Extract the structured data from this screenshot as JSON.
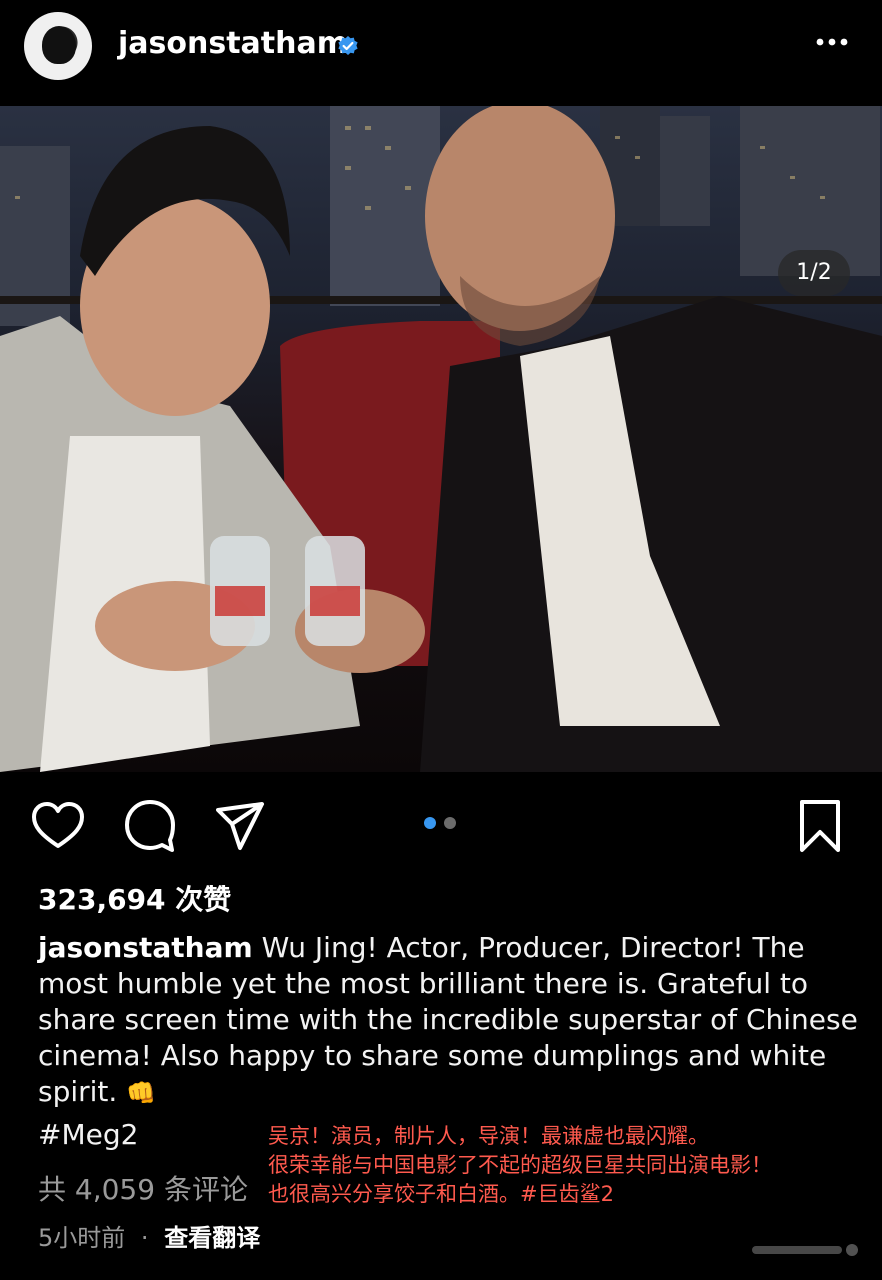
{
  "header": {
    "username": "jasonstatham",
    "verified_icon": "verified-badge-icon",
    "more_icon": "more-options-icon"
  },
  "post": {
    "page_indicator": "1/2",
    "carousel": {
      "current": 1,
      "total": 2
    },
    "actions": {
      "like_icon": "heart-icon",
      "comment_icon": "comment-bubble-icon",
      "share_icon": "send-paper-plane-icon",
      "save_icon": "bookmark-icon"
    },
    "likes_text": "323,694 次赞",
    "caption": {
      "username": "jasonstatham",
      "text": "Wu Jing! Actor, Producer, Director! The most humble yet the most brilliant there is. Grateful to share screen time with the incredible superstar of Chinese cinema! Also happy to share some dumplings and white spirit.",
      "emoji": "👊"
    },
    "hashtag": "#Meg2",
    "comments_text": "共 4,059 条评论",
    "time_ago": "5小时前",
    "separator": "·",
    "translate_label": "查看翻译"
  },
  "overlay_translation": {
    "lines": [
      "吴京！演员，制片人，导演！最谦虚也最闪耀。",
      "很荣幸能与中国电影了不起的超级巨星共同出演电影！",
      "也很高兴分享饺子和白酒。#巨齿鲨2"
    ]
  },
  "colors": {
    "background": "#000000",
    "accent_blue": "#3897f0",
    "muted_text": "#9a9a9a",
    "overlay_red": "#ff5a4e"
  }
}
